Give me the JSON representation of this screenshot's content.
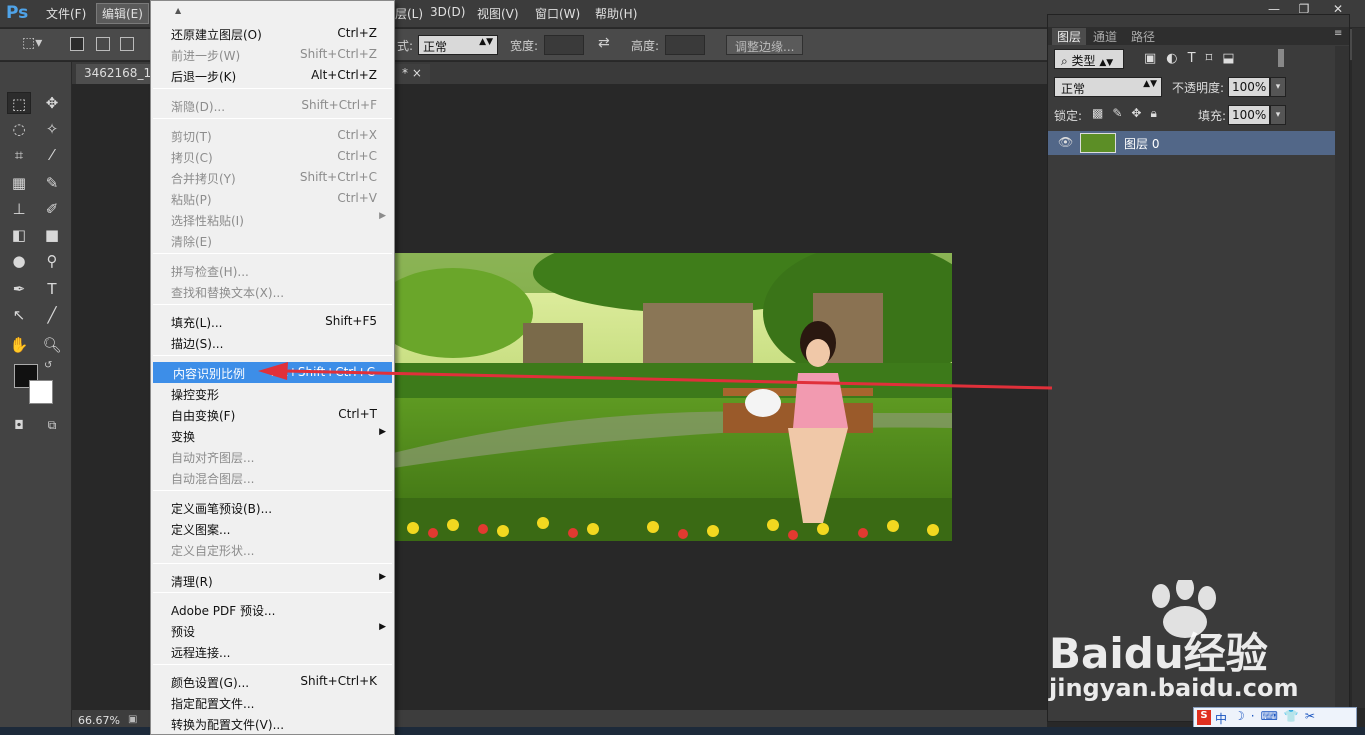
{
  "app": {
    "logo": "Ps",
    "menus": [
      "文件(F)",
      "编辑(E)",
      "图(I)",
      "3D(D)",
      "视图(V)",
      "窗口(W)",
      "帮助(H)"
    ],
    "menu_partial": "层(L)"
  },
  "options": {
    "style_label": "式:",
    "style_value": "正常",
    "width_label": "宽度:",
    "height_label": "高度:",
    "refine_button": "调整边缘..."
  },
  "document": {
    "tab_title": "3462168_14",
    "tab_tail": "* ×",
    "zoom": "66.67%"
  },
  "edit_menu": {
    "items": [
      {
        "label": "还原建立图层(O)",
        "shortcut": "Ctrl+Z",
        "disabled": false
      },
      {
        "label": "前进一步(W)",
        "shortcut": "Shift+Ctrl+Z",
        "disabled": true
      },
      {
        "label": "后退一步(K)",
        "shortcut": "Alt+Ctrl+Z",
        "disabled": false
      },
      {
        "label": "渐隐(D)...",
        "shortcut": "Shift+Ctrl+F",
        "disabled": true
      },
      {
        "label": "剪切(T)",
        "shortcut": "Ctrl+X",
        "disabled": true
      },
      {
        "label": "拷贝(C)",
        "shortcut": "Ctrl+C",
        "disabled": true
      },
      {
        "label": "合并拷贝(Y)",
        "shortcut": "Shift+Ctrl+C",
        "disabled": true
      },
      {
        "label": "粘贴(P)",
        "shortcut": "Ctrl+V",
        "disabled": true
      },
      {
        "label": "选择性粘贴(I)",
        "shortcut": "",
        "disabled": true,
        "submenu": true
      },
      {
        "label": "清除(E)",
        "shortcut": "",
        "disabled": true
      },
      {
        "label": "拼写检查(H)...",
        "shortcut": "",
        "disabled": true
      },
      {
        "label": "查找和替换文本(X)...",
        "shortcut": "",
        "disabled": true
      },
      {
        "label": "填充(L)...",
        "shortcut": "Shift+F5",
        "disabled": false
      },
      {
        "label": "描边(S)...",
        "shortcut": "",
        "disabled": false
      },
      {
        "label": "内容识别比例",
        "shortcut": "Alt+Shift+Ctrl+C",
        "disabled": false,
        "highlighted": true
      },
      {
        "label": "操控变形",
        "shortcut": "",
        "disabled": false
      },
      {
        "label": "自由变换(F)",
        "shortcut": "Ctrl+T",
        "disabled": false
      },
      {
        "label": "变换",
        "shortcut": "",
        "disabled": false,
        "submenu": true
      },
      {
        "label": "自动对齐图层...",
        "shortcut": "",
        "disabled": true
      },
      {
        "label": "自动混合图层...",
        "shortcut": "",
        "disabled": true
      },
      {
        "label": "定义画笔预设(B)...",
        "shortcut": "",
        "disabled": false
      },
      {
        "label": "定义图案...",
        "shortcut": "",
        "disabled": false
      },
      {
        "label": "定义自定形状...",
        "shortcut": "",
        "disabled": true
      },
      {
        "label": "清理(R)",
        "shortcut": "",
        "disabled": false,
        "submenu": true
      },
      {
        "label": "Adobe PDF 预设...",
        "shortcut": "",
        "disabled": false
      },
      {
        "label": "预设",
        "shortcut": "",
        "disabled": false,
        "submenu": true
      },
      {
        "label": "远程连接...",
        "shortcut": "",
        "disabled": false
      },
      {
        "label": "颜色设置(G)...",
        "shortcut": "Shift+Ctrl+K",
        "disabled": false
      },
      {
        "label": "指定配置文件...",
        "shortcut": "",
        "disabled": false
      },
      {
        "label": "转换为配置文件(V)...",
        "shortcut": "",
        "disabled": false
      }
    ]
  },
  "layers_panel": {
    "tabs": [
      "图层",
      "通道",
      "路径"
    ],
    "filter": "类型",
    "blend_mode": "正常",
    "opacity_label": "不透明度:",
    "opacity": "100%",
    "lock_label": "锁定:",
    "fill_label": "填充:",
    "fill": "100%",
    "layer_name": "图层 0"
  },
  "watermark": {
    "brand": "Baidu经验",
    "url": "jingyan.baidu.com"
  },
  "ime": {
    "label": "中"
  },
  "colors": {
    "highlight": "#3d8ee8",
    "arrow": "#e0303a",
    "layer_selected": "#526788"
  }
}
